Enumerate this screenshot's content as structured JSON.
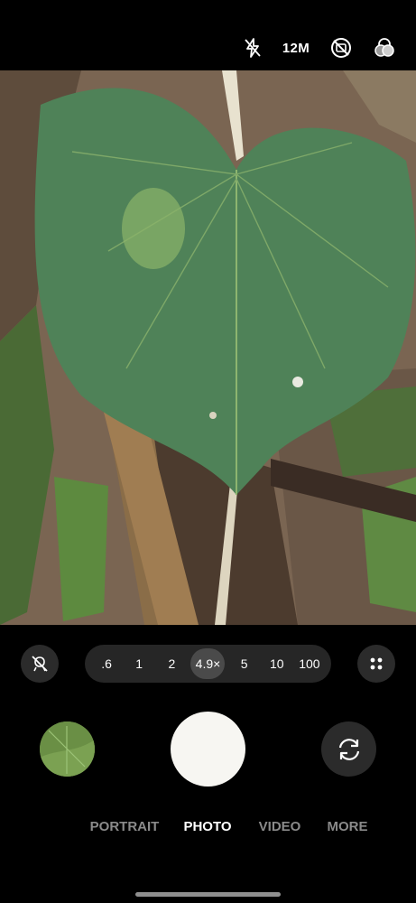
{
  "top_bar": {
    "flash_icon": "flash-off-icon",
    "resolution": "12M",
    "motion_icon": "motion-photo-off-icon",
    "filter_icon": "filters-icon"
  },
  "viewfinder": {
    "subject": "leaf-preview"
  },
  "zoom": {
    "scene_optimizer_icon": "scene-optimizer-off-icon",
    "options": [
      ".6",
      "1",
      "2",
      "4.9×",
      "5",
      "10",
      "100"
    ],
    "selected": "4.9×",
    "grid_icon": "more-options-dots-icon"
  },
  "controls": {
    "gallery_icon": "gallery-thumbnail",
    "shutter_icon": "shutter-button",
    "flip_icon": "switch-camera-icon"
  },
  "modes": {
    "items": [
      "PORTRAIT",
      "PHOTO",
      "VIDEO",
      "MORE"
    ],
    "active": "PHOTO"
  },
  "colors": {
    "background": "#000000",
    "shutter": "#f7f6f2",
    "inactive_mode": "#8a8a8a",
    "button_bg": "#2b2b2b"
  }
}
